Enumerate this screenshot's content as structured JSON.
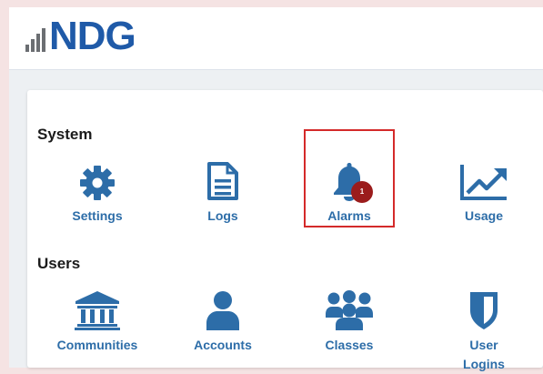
{
  "brand": {
    "logo_text": "NDG",
    "colors": {
      "primary": "#1f5aa8",
      "accent": "#2d6da8",
      "badge": "#9b1c1c",
      "highlight": "#d42a2a"
    }
  },
  "system": {
    "title": "System",
    "items": [
      {
        "label": "Settings",
        "icon": "gear-icon"
      },
      {
        "label": "Logs",
        "icon": "document-icon"
      },
      {
        "label": "Alarms",
        "icon": "bell-icon",
        "badge": "1"
      },
      {
        "label": "Usage",
        "icon": "line-chart-icon"
      }
    ]
  },
  "users": {
    "title": "Users",
    "items": [
      {
        "label": "Communities",
        "icon": "institution-icon"
      },
      {
        "label": "Accounts",
        "icon": "user-icon"
      },
      {
        "label": "Classes",
        "icon": "users-group-icon"
      },
      {
        "label": "User Logins",
        "label_line1": "User",
        "label_line2": "Logins",
        "icon": "shield-icon"
      }
    ]
  }
}
